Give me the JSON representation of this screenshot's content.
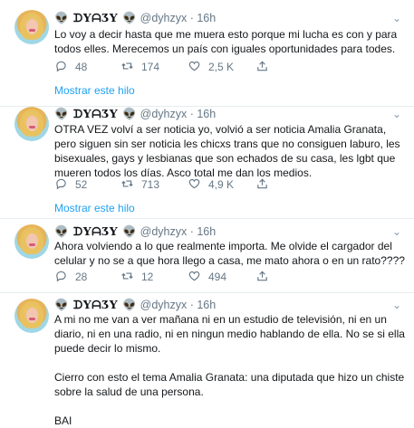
{
  "account": {
    "display_name": "👽 ᗪYᗩƷY 👽",
    "handle": "@dyhzyx",
    "separator": "·"
  },
  "tweets": [
    {
      "time": "16h",
      "text": "Lo voy a decir hasta que me muera esto porque mi lucha es con y para todos elles. Merecemos un país con iguales oportunidades para todes.",
      "replies": "48",
      "retweets": "174",
      "likes": "2,5 K",
      "show_thread": "Mostrar este hilo"
    },
    {
      "time": "16h",
      "text": "OTRA VEZ volví a ser noticia yo, volvió a ser noticia Amalia Granata, pero siguen sin ser noticia les chicxs trans que no consiguen laburo, les bisexuales, gays y lesbianas que son echados de su casa, les lgbt que mueren todos los días. Asco total me dan los medios.",
      "replies": "52",
      "retweets": "713",
      "likes": "4,9 K",
      "show_thread": "Mostrar este hilo"
    },
    {
      "time": "16h",
      "text": "Ahora volviendo a lo que realmente importa. Me olvide el cargador del celular y no se a que hora llego a casa, me mato ahora o en un rato????",
      "replies": "28",
      "retweets": "12",
      "likes": "494"
    },
    {
      "time": "16h",
      "text": "A mi no me van a ver mañana ni en un estudio de televisión, ni en un diario, ni en una radio, ni en ningun medio hablando de ella. No se si ella puede decir lo mismo.\n\nCierro con esto el tema Amalia Granata: una diputada que hizo un chiste sobre la salud de una persona.\n\nBAI"
    }
  ],
  "icons": {
    "reply": "reply-icon",
    "retweet": "retweet-icon",
    "like": "heart-icon",
    "share": "share-icon",
    "more": "chevron-down-icon"
  },
  "colors": {
    "link": "#1da1f2",
    "muted": "#657786",
    "divider": "#e6ecf0"
  }
}
